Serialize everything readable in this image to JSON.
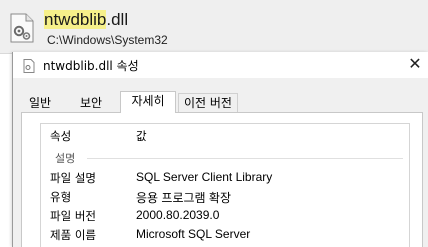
{
  "result": {
    "file_name_highlight": "ntwdblib",
    "file_name_rest": ".dll",
    "file_path": "C:\\Windows\\System32",
    "icon": "dll-file-icon"
  },
  "dialog": {
    "title": "ntwdblib.dll 속성",
    "close_glyph": "✕",
    "tabs": [
      {
        "label": "일반"
      },
      {
        "label": "보안"
      },
      {
        "label": "자세히"
      },
      {
        "label": "이전 버전"
      }
    ],
    "details": {
      "columns": {
        "property": "속성",
        "value": "값"
      },
      "group": "설명",
      "rows": [
        {
          "key": "파일 설명",
          "value": "SQL Server Client Library"
        },
        {
          "key": "유형",
          "value": "응용 프로그램 확장"
        },
        {
          "key": "파일 버전",
          "value": "2000.80.2039.0"
        },
        {
          "key": "제품 이름",
          "value": "Microsoft SQL Server"
        }
      ]
    }
  },
  "colors": {
    "highlight": "#f6f08a",
    "header_bg": "#efefef",
    "dialog_bg": "#f0f0f0"
  }
}
